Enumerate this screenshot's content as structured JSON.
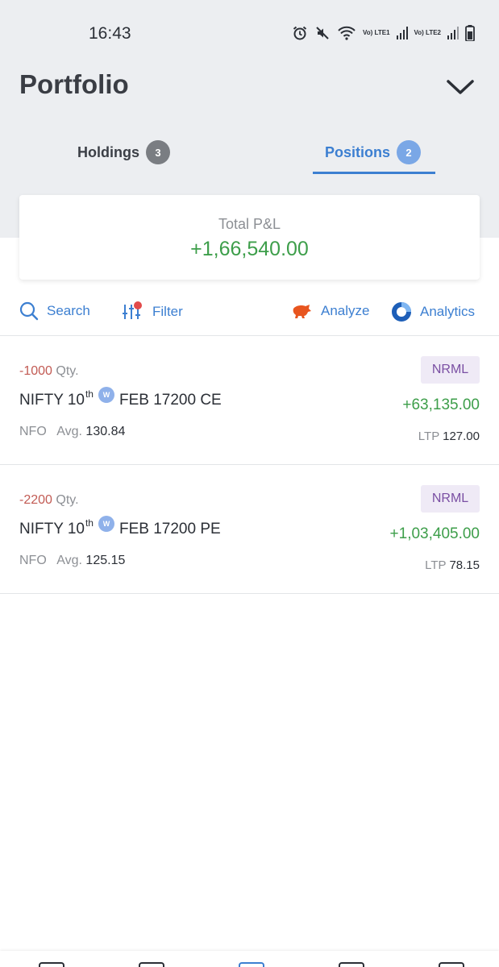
{
  "status_bar": {
    "time": "16:43",
    "sim1": "Vo) LTE1",
    "sim2": "Vo) LTE2"
  },
  "header": {
    "title": "Portfolio",
    "toggle_icon": "chevron-down-icon"
  },
  "tabs": [
    {
      "label": "Holdings",
      "count": "3",
      "active": false
    },
    {
      "label": "Positions",
      "count": "2",
      "active": true
    }
  ],
  "summary": {
    "label": "Total P&L",
    "value": "+1,66,540.00"
  },
  "toolbar": {
    "search": "Search",
    "filter": "Filter",
    "analyze": "Analyze",
    "analytics": "Analytics"
  },
  "positions": [
    {
      "qty": "-1000",
      "qty_label": "Qty.",
      "symbol": "NIFTY 10",
      "symbol_sup": "th",
      "weekly": "W",
      "symbol_rest": "FEB 17200 CE",
      "exchange": "NFO",
      "avg_label": "Avg.",
      "avg": "130.84",
      "product": "NRML",
      "pnl": "+63,135.00",
      "ltp_label": "LTP",
      "ltp": "127.00"
    },
    {
      "qty": "-2200",
      "qty_label": "Qty.",
      "symbol": "NIFTY 10",
      "symbol_sup": "th",
      "weekly": "W",
      "symbol_rest": "FEB 17200 PE",
      "exchange": "NFO",
      "avg_label": "Avg.",
      "avg": "125.15",
      "product": "NRML",
      "pnl": "+1,03,405.00",
      "ltp_label": "LTP",
      "ltp": "78.15"
    }
  ],
  "colors": {
    "accent": "#3c7fd1",
    "profit": "#3d9e4a",
    "loss": "#c25b54",
    "product_badge": "#7a4fa3"
  }
}
